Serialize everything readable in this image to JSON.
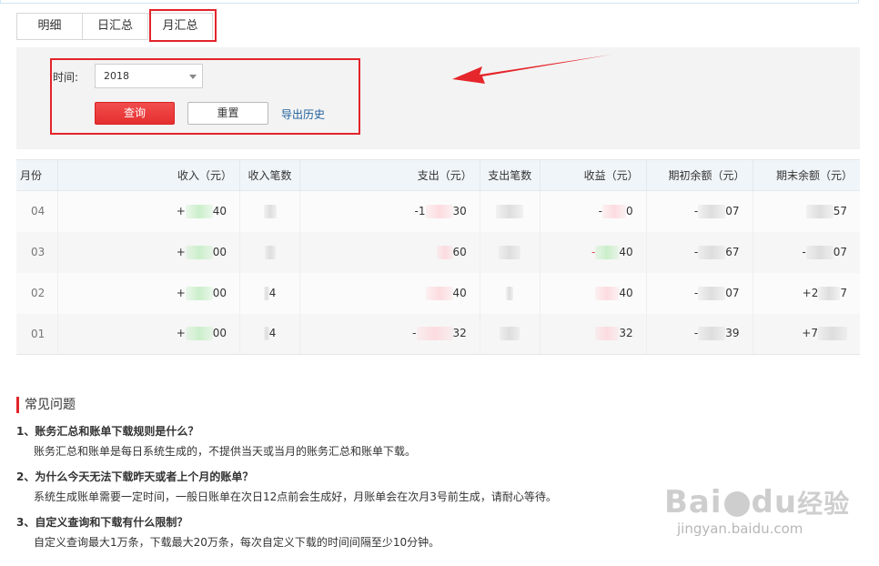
{
  "tabs": [
    {
      "label": "明细"
    },
    {
      "label": "日汇总"
    },
    {
      "label": "月汇总",
      "active": true
    }
  ],
  "filter": {
    "time_label": "时间:",
    "year": "2018",
    "query_button": "查询",
    "reset_button": "重置",
    "export_link": "导出历史"
  },
  "table": {
    "headers": [
      "月份",
      "收入（元）",
      "收入笔数",
      "支出（元）",
      "支出笔数",
      "收益（元）",
      "期初余额（元）",
      "期末余额（元）"
    ],
    "rows": [
      {
        "month": "04",
        "income": "+",
        "income_tail": "40",
        "income_count": "",
        "expense": "-1",
        "expense_tail": "30",
        "expense_count": "",
        "profit": "-",
        "profit_tail": "0",
        "opening": "-",
        "opening_tail": "07",
        "closing": "",
        "closing_tail": "57"
      },
      {
        "month": "03",
        "income": "+",
        "income_tail": "00",
        "income_count": "",
        "expense": "",
        "expense_tail": "60",
        "expense_count": "",
        "profit": "-",
        "profit_tail": "40",
        "opening": "-",
        "opening_tail": "67",
        "closing": "-",
        "closing_tail": "07"
      },
      {
        "month": "02",
        "income": "+",
        "income_tail": "00",
        "income_count": "4",
        "expense": "",
        "expense_tail": "40",
        "expense_count": "",
        "profit": "",
        "profit_tail": "40",
        "opening": "-",
        "opening_tail": "07",
        "closing": "+2",
        "closing_tail": "7"
      },
      {
        "month": "01",
        "income": "+",
        "income_tail": "00",
        "income_count": "4",
        "expense": "-",
        "expense_tail": "32",
        "expense_count": "",
        "profit": "",
        "profit_tail": "32",
        "opening": "-",
        "opening_tail": "39",
        "closing": "+7",
        "closing_tail": ""
      }
    ]
  },
  "faq": {
    "title": "常见问题",
    "items": [
      {
        "q": "1、账务汇总和账单下载规则是什么？",
        "a": "账务汇总和账单是每日系统生成的，不提供当天或当月的账务汇总和账单下载。"
      },
      {
        "q": "2、为什么今天无法下载昨天或者上个月的账单？",
        "a": "系统生成账单需要一定时间，一般日账单在次日12点前会生成好，月账单会在次月3号前生成，请耐心等待。"
      },
      {
        "q": "3、自定义查询和下载有什么限制？",
        "a": "自定义查询最大1万条，下载最大20万条，每次自定义下载的时间间隔至少10分钟。"
      }
    ]
  },
  "watermark": {
    "top_left": "Bai",
    "top_right": "du",
    "top_cn": "经验",
    "bottom": "jingyan.baidu.com"
  },
  "colors": {
    "accent_red": "#e2242a",
    "link": "#1f5f9b",
    "income": "#2c9b2c",
    "expense": "#e2464c"
  }
}
